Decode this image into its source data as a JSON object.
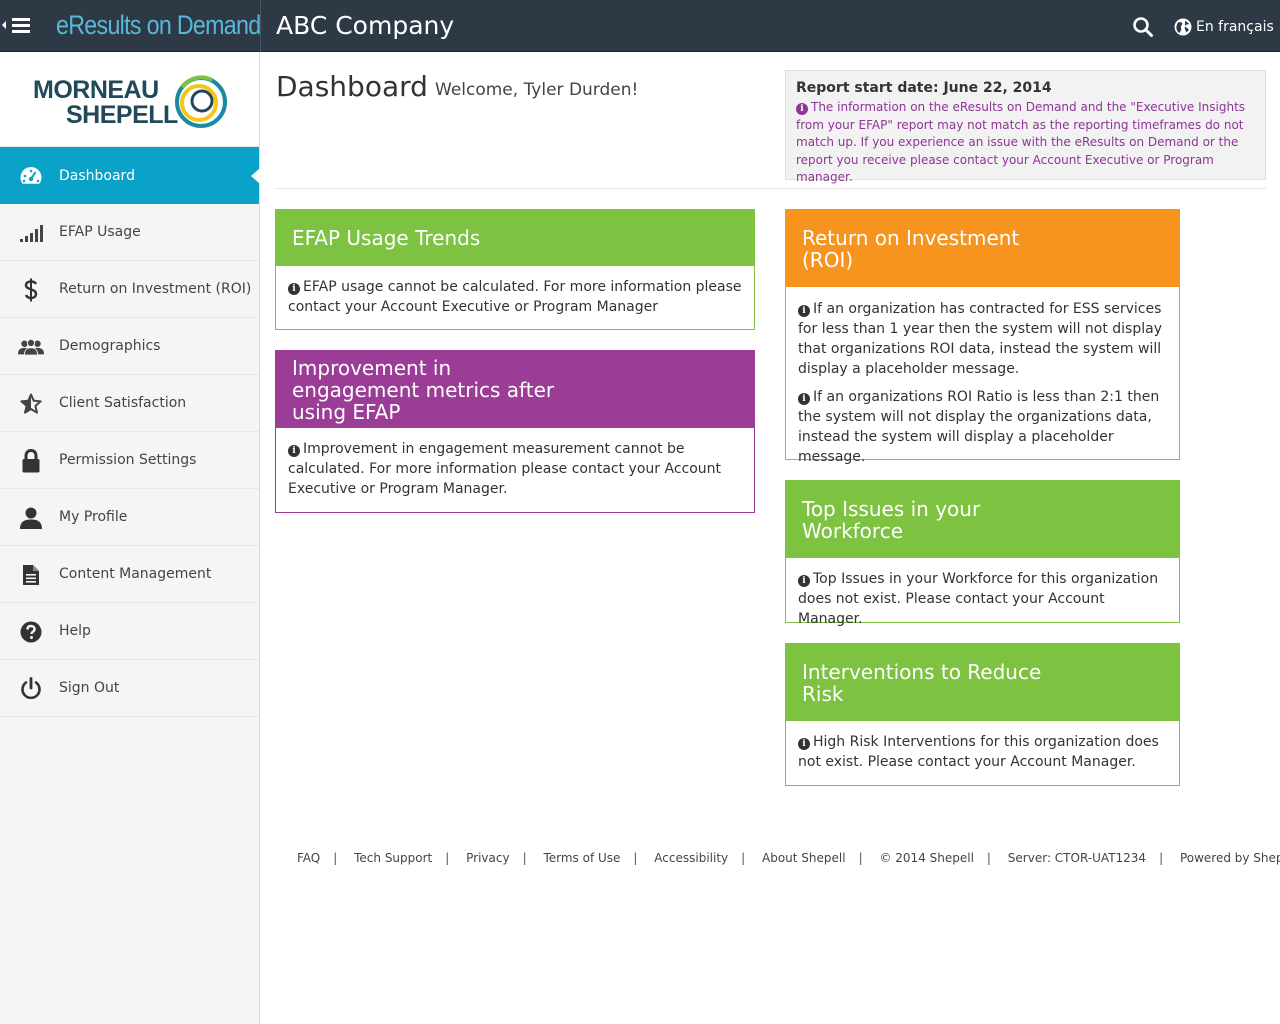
{
  "header": {
    "brand": "eResults on Demand",
    "company": "ABC Company",
    "language_label": "En français"
  },
  "sidebar": {
    "logo": {
      "line1": "MORNEAU",
      "line2": "SHEPELL"
    },
    "items": [
      {
        "label": "Dashboard",
        "icon": "dashboard-icon"
      },
      {
        "label": "EFAP Usage",
        "icon": "signal-bars-icon"
      },
      {
        "label": "Return on Investment (ROI)",
        "icon": "dollar-icon"
      },
      {
        "label": "Demographics",
        "icon": "users-icon"
      },
      {
        "label": "Client Satisfaction",
        "icon": "star-icon"
      },
      {
        "label": "Permission Settings",
        "icon": "lock-icon"
      },
      {
        "label": "My Profile",
        "icon": "user-icon"
      },
      {
        "label": "Content Management",
        "icon": "document-icon"
      },
      {
        "label": "Help",
        "icon": "question-icon"
      },
      {
        "label": "Sign Out",
        "icon": "power-icon"
      }
    ]
  },
  "main": {
    "title": "Dashboard",
    "welcome": "Welcome, Tyler Durden!",
    "report": {
      "start_date": "Report start date: June 22, 2014",
      "note": "The information on the eResults on Demand and the \"Executive Insights from your EFAP\" report may not match as the reporting timeframes do not match up. If you experience an issue with the eResults on Demand or the report you receive please contact your Account Executive or Program manager."
    },
    "panels": {
      "usage": {
        "title": "EFAP Usage Trends",
        "body": "EFAP usage cannot be calculated. For more information please contact your Account Executive or Program Manager"
      },
      "engagement": {
        "title": "Improvement in engagement metrics after using EFAP",
        "body": "Improvement in engagement measurement cannot be calculated. For more information please contact your Account Executive or Program Manager."
      },
      "roi": {
        "title": "Return on Investment (ROI)",
        "body1": "If an organization has contracted for ESS services for less than 1 year then the system will not display that organizations ROI data, instead the system will display a placeholder message.",
        "body2": "If an organizations ROI Ratio is less than 2:1 then the system will not display the organizations data, instead the system will display a placeholder message."
      },
      "issues": {
        "title": "Top Issues in your Workforce",
        "body": "Top Issues in your Workforce for this organization does not exist. Please contact your Account Manager."
      },
      "interventions": {
        "title": "Interventions to Reduce Risk",
        "body": "High Risk Interventions for this organization does not exist. Please contact your Account Manager."
      }
    }
  },
  "footer": {
    "links": [
      "FAQ",
      "Tech Support",
      "Privacy",
      "Terms of Use",
      "Accessibility",
      "About Shepell",
      "© 2014 Shepell",
      "Server: CTOR-UAT1234",
      "Powered by Shepell"
    ],
    "separator": "|"
  },
  "colors": {
    "topbar": "#2d3a46",
    "active_nav": "#0aa2c9",
    "green": "#7dc241",
    "purple": "#9b3d96",
    "orange": "#f7941d",
    "note_text": "#8e3596"
  }
}
